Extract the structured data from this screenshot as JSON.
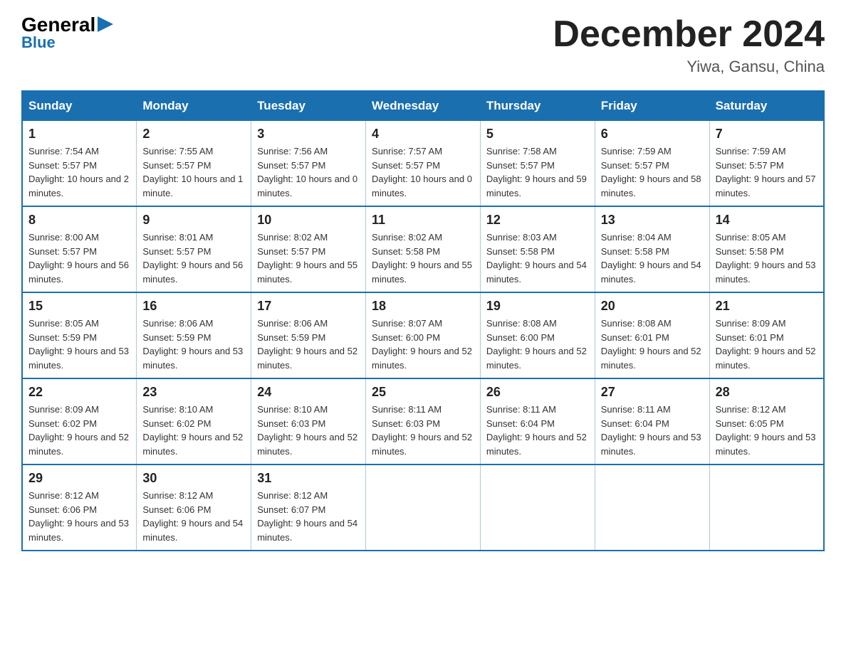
{
  "logo": {
    "part1": "General",
    "arrow": "▶",
    "part2": "Blue"
  },
  "title": "December 2024",
  "location": "Yiwa, Gansu, China",
  "days_header": [
    "Sunday",
    "Monday",
    "Tuesday",
    "Wednesday",
    "Thursday",
    "Friday",
    "Saturday"
  ],
  "weeks": [
    [
      {
        "day": "1",
        "sunrise": "7:54 AM",
        "sunset": "5:57 PM",
        "daylight": "10 hours and 2 minutes."
      },
      {
        "day": "2",
        "sunrise": "7:55 AM",
        "sunset": "5:57 PM",
        "daylight": "10 hours and 1 minute."
      },
      {
        "day": "3",
        "sunrise": "7:56 AM",
        "sunset": "5:57 PM",
        "daylight": "10 hours and 0 minutes."
      },
      {
        "day": "4",
        "sunrise": "7:57 AM",
        "sunset": "5:57 PM",
        "daylight": "10 hours and 0 minutes."
      },
      {
        "day": "5",
        "sunrise": "7:58 AM",
        "sunset": "5:57 PM",
        "daylight": "9 hours and 59 minutes."
      },
      {
        "day": "6",
        "sunrise": "7:59 AM",
        "sunset": "5:57 PM",
        "daylight": "9 hours and 58 minutes."
      },
      {
        "day": "7",
        "sunrise": "7:59 AM",
        "sunset": "5:57 PM",
        "daylight": "9 hours and 57 minutes."
      }
    ],
    [
      {
        "day": "8",
        "sunrise": "8:00 AM",
        "sunset": "5:57 PM",
        "daylight": "9 hours and 56 minutes."
      },
      {
        "day": "9",
        "sunrise": "8:01 AM",
        "sunset": "5:57 PM",
        "daylight": "9 hours and 56 minutes."
      },
      {
        "day": "10",
        "sunrise": "8:02 AM",
        "sunset": "5:57 PM",
        "daylight": "9 hours and 55 minutes."
      },
      {
        "day": "11",
        "sunrise": "8:02 AM",
        "sunset": "5:58 PM",
        "daylight": "9 hours and 55 minutes."
      },
      {
        "day": "12",
        "sunrise": "8:03 AM",
        "sunset": "5:58 PM",
        "daylight": "9 hours and 54 minutes."
      },
      {
        "day": "13",
        "sunrise": "8:04 AM",
        "sunset": "5:58 PM",
        "daylight": "9 hours and 54 minutes."
      },
      {
        "day": "14",
        "sunrise": "8:05 AM",
        "sunset": "5:58 PM",
        "daylight": "9 hours and 53 minutes."
      }
    ],
    [
      {
        "day": "15",
        "sunrise": "8:05 AM",
        "sunset": "5:59 PM",
        "daylight": "9 hours and 53 minutes."
      },
      {
        "day": "16",
        "sunrise": "8:06 AM",
        "sunset": "5:59 PM",
        "daylight": "9 hours and 53 minutes."
      },
      {
        "day": "17",
        "sunrise": "8:06 AM",
        "sunset": "5:59 PM",
        "daylight": "9 hours and 52 minutes."
      },
      {
        "day": "18",
        "sunrise": "8:07 AM",
        "sunset": "6:00 PM",
        "daylight": "9 hours and 52 minutes."
      },
      {
        "day": "19",
        "sunrise": "8:08 AM",
        "sunset": "6:00 PM",
        "daylight": "9 hours and 52 minutes."
      },
      {
        "day": "20",
        "sunrise": "8:08 AM",
        "sunset": "6:01 PM",
        "daylight": "9 hours and 52 minutes."
      },
      {
        "day": "21",
        "sunrise": "8:09 AM",
        "sunset": "6:01 PM",
        "daylight": "9 hours and 52 minutes."
      }
    ],
    [
      {
        "day": "22",
        "sunrise": "8:09 AM",
        "sunset": "6:02 PM",
        "daylight": "9 hours and 52 minutes."
      },
      {
        "day": "23",
        "sunrise": "8:10 AM",
        "sunset": "6:02 PM",
        "daylight": "9 hours and 52 minutes."
      },
      {
        "day": "24",
        "sunrise": "8:10 AM",
        "sunset": "6:03 PM",
        "daylight": "9 hours and 52 minutes."
      },
      {
        "day": "25",
        "sunrise": "8:11 AM",
        "sunset": "6:03 PM",
        "daylight": "9 hours and 52 minutes."
      },
      {
        "day": "26",
        "sunrise": "8:11 AM",
        "sunset": "6:04 PM",
        "daylight": "9 hours and 52 minutes."
      },
      {
        "day": "27",
        "sunrise": "8:11 AM",
        "sunset": "6:04 PM",
        "daylight": "9 hours and 53 minutes."
      },
      {
        "day": "28",
        "sunrise": "8:12 AM",
        "sunset": "6:05 PM",
        "daylight": "9 hours and 53 minutes."
      }
    ],
    [
      {
        "day": "29",
        "sunrise": "8:12 AM",
        "sunset": "6:06 PM",
        "daylight": "9 hours and 53 minutes."
      },
      {
        "day": "30",
        "sunrise": "8:12 AM",
        "sunset": "6:06 PM",
        "daylight": "9 hours and 54 minutes."
      },
      {
        "day": "31",
        "sunrise": "8:12 AM",
        "sunset": "6:07 PM",
        "daylight": "9 hours and 54 minutes."
      },
      null,
      null,
      null,
      null
    ]
  ]
}
